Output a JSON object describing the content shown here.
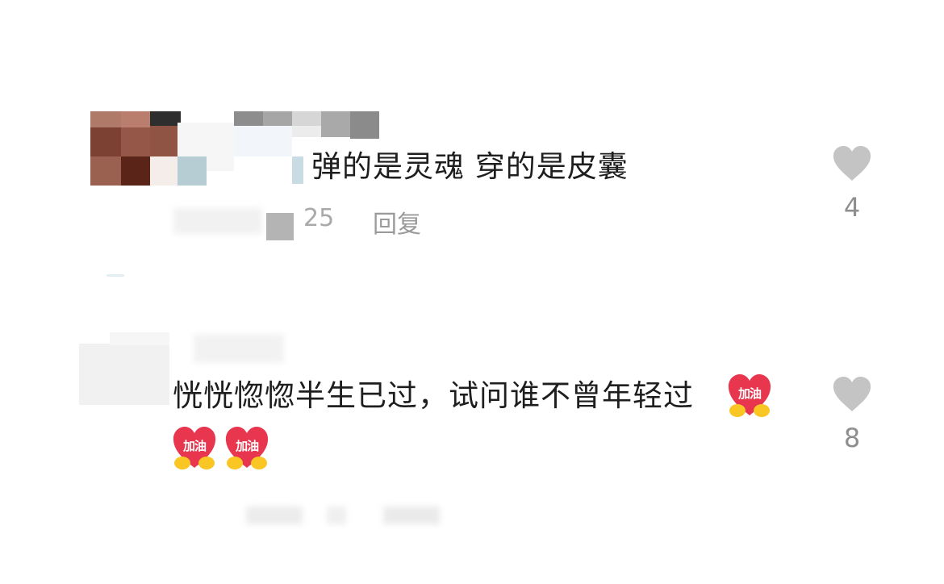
{
  "comments": [
    {
      "text": "弹的是灵魂 穿的是皮囊",
      "meta_count": "25",
      "reply_label": "回复",
      "like_count": "4"
    },
    {
      "text": "恍恍惚惚半生已过，试问谁不曾年轻过",
      "stickers": [
        {
          "icon": "jiayou-heart-sticker",
          "label": "加油"
        },
        {
          "icon": "jiayou-heart-sticker",
          "label": "加油"
        },
        {
          "icon": "jiayou-heart-sticker",
          "label": "加油"
        }
      ],
      "like_count": "8"
    }
  ],
  "icons": {
    "like": "heart-icon"
  },
  "colors": {
    "text": "#1e1e1e",
    "meta": "#a9a9a9",
    "heart": "#c4c4c4",
    "sticker_red": "#e8364f",
    "sticker_yellow": "#f9c624"
  }
}
